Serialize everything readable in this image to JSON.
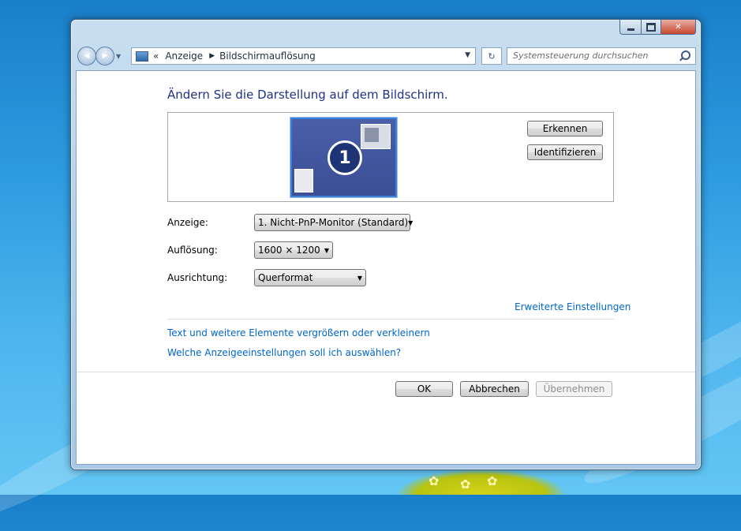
{
  "window": {
    "caption_buttons": {
      "minimize_icon": "minimize-icon",
      "maximize_icon": "maximize-icon",
      "close_icon": "close-icon",
      "close_glyph": "✕"
    }
  },
  "navbar": {
    "back_glyph": "◀",
    "forward_glyph": "▶",
    "history_dropdown_glyph": "▼",
    "breadcrumb_overflow": "«",
    "breadcrumbs": [
      "Anzeige",
      "Bildschirmauflösung"
    ],
    "crumb_separator": "▶",
    "address_dropdown_glyph": "▼",
    "refresh_glyph": "↻",
    "search_placeholder": "Systemsteuerung durchsuchen"
  },
  "content": {
    "title": "Ändern Sie die Darstellung auf dem Bildschirm.",
    "monitor_number": "1",
    "detect_button": "Erkennen",
    "identify_button": "Identifizieren",
    "settings": {
      "display_label": "Anzeige:",
      "display_value": "1. Nicht-PnP-Monitor (Standard)",
      "resolution_label": "Auflösung:",
      "resolution_value": "1600 × 1200",
      "orientation_label": "Ausrichtung:",
      "orientation_value": "Querformat"
    },
    "advanced_link": "Erweiterte Einstellungen",
    "links": [
      "Text und weitere Elemente vergrößern oder verkleinern",
      "Welche Anzeigeeinstellungen soll ich auswählen?"
    ],
    "buttons": {
      "ok": "OK",
      "cancel": "Abbrechen",
      "apply": "Übernehmen"
    },
    "dropdown_arrow": "▼"
  },
  "colors": {
    "title_blue": "#1e3287",
    "link_blue": "#0066cc",
    "accent_border": "#3c7fd8"
  }
}
